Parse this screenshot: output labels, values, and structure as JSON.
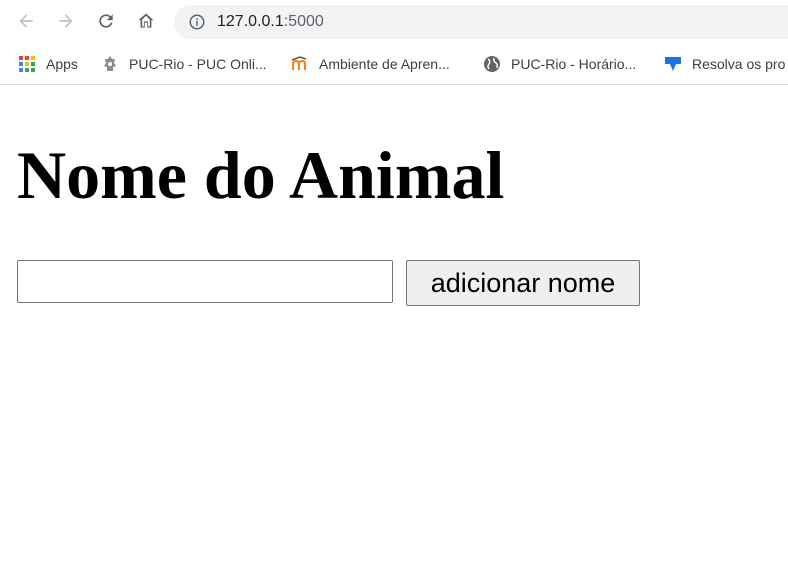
{
  "browser": {
    "url_host": "127.0.0.1",
    "url_port": ":5000",
    "bookmarks": [
      {
        "label": "Apps",
        "icon": "apps-grid-icon"
      },
      {
        "label": "PUC-Rio - PUC Onli...",
        "icon": "puc-crest-icon"
      },
      {
        "label": "Ambiente de Apren...",
        "icon": "moodle-icon"
      },
      {
        "label": "PUC-Rio - Horário...",
        "icon": "globe-icon"
      },
      {
        "label": "Resolva os pro",
        "icon": "blue-bookmark-icon"
      }
    ]
  },
  "page": {
    "title": "Nome do Animal",
    "input_value": "",
    "button_label": "adicionar nome"
  }
}
